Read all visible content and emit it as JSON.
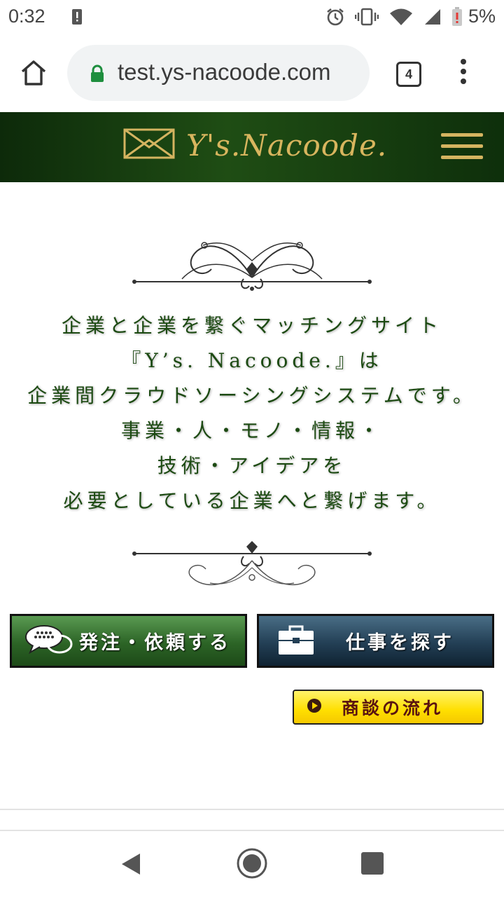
{
  "status_bar": {
    "time": "0:32",
    "battery_percent": "5%",
    "icons": [
      "alert-icon",
      "alarm-icon",
      "vibrate-icon",
      "wifi-icon",
      "cell-signal-icon",
      "battery-low-icon"
    ]
  },
  "browser": {
    "url": "test.ys-nacoode.com",
    "tab_count": "4",
    "icons": [
      "home-icon",
      "lock-icon",
      "more-vert-icon"
    ]
  },
  "site": {
    "logo_text": "Y's.Nacoode.",
    "accent_gold": "#d4b460",
    "header_green": "#1f4d14"
  },
  "intro": {
    "lines": [
      "企業と企業を繋ぐマッチングサイト",
      "『Y’s. Nacoode.』は",
      "企業間クラウドソーシングシステムです。",
      "事業・人・モノ・情報・",
      "技術・アイデアを",
      "必要としている企業へと繋げます。"
    ]
  },
  "buttons": {
    "order_label": "発注・依頼する",
    "job_label": "仕事を探す",
    "flow_label": "商談の流れ"
  }
}
